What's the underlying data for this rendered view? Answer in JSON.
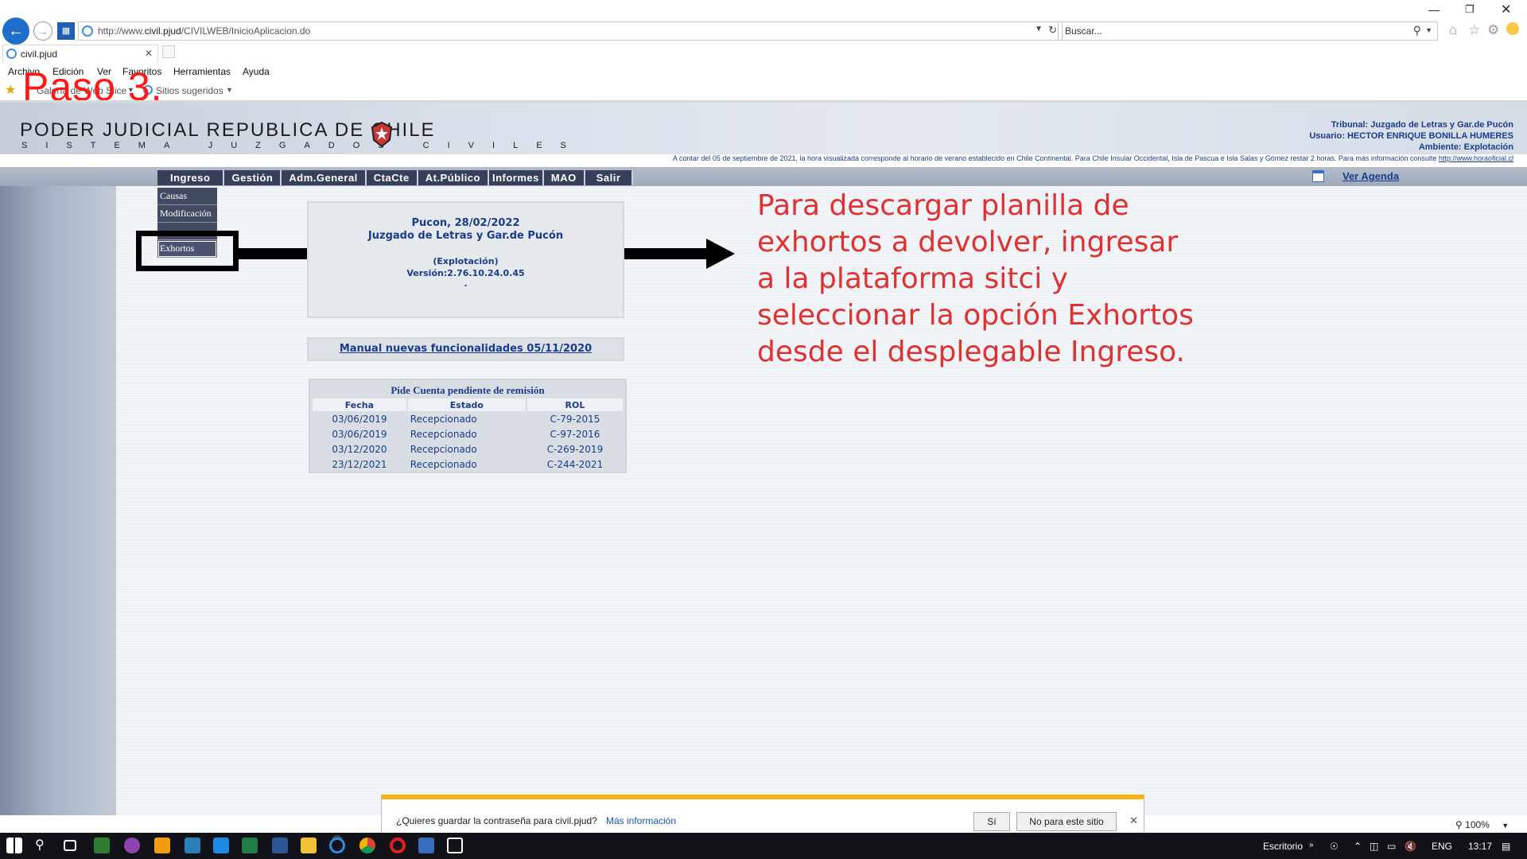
{
  "browser": {
    "url_prefix": "http://www.",
    "url_host": "civil.pjud",
    "url_path": "/CIVILWEB/InicioAplicacion.do",
    "search_placeholder": "Buscar...",
    "tab_title": "civil.pjud",
    "menu": [
      "Archivo",
      "Edición",
      "Ver",
      "Favoritos",
      "Herramientas",
      "Ayuda"
    ],
    "favorites": [
      "Galería de Web Slice",
      "Sitios sugeridos"
    ],
    "zoom": "100%"
  },
  "overlay": {
    "step_label": "Paso 3.",
    "annotation": "Para descargar planilla de exhortos a devolver, ingresar a la plataforma sitci y seleccionar la opción Exhortos desde el desplegable Ingreso."
  },
  "header": {
    "logo_title": "PODER JUDICIAL REPUBLICA DE CHILE",
    "logo_subtitle": "SISTEMA JUZGADOS CIVILES",
    "tribunal": "Tribunal: Juzgado de Letras y Gar.de Pucón",
    "usuario": "Usuario: HECTOR ENRIQUE BONILLA HUMERES",
    "ambiente": "Ambiente: Explotación",
    "notice": "A contar del 05 de septiembre de 2021, la hora visualizada corresponde al horario de verano establecido en Chile Continental. Para Chile Insular Occidental, Isla de Pascua e Isla Salas y Gómez restar 2 horas. Para más información consulte",
    "notice_link": "http://www.horaoficial.cl"
  },
  "nav": {
    "items": [
      "Ingreso",
      "Gestión",
      "Adm.General",
      "CtaCte",
      "At.Público",
      "Informes",
      "MAO",
      "Salir"
    ],
    "agenda": "Ver Agenda"
  },
  "ingreso_menu": [
    "Causas",
    "Modificación",
    "Exhortos"
  ],
  "info_panel": {
    "date_line": "Pucon, 28/02/2022",
    "court": "Juzgado de Letras y Gar.de Pucón",
    "env": "(Explotación)",
    "version": "Versión:2.76.10.24.0.45",
    "dot": "."
  },
  "manual_link": "Manual nuevas funcionalidades 05/11/2020",
  "pending_table": {
    "title": "Pide Cuenta pendiente de remisión",
    "headers": [
      "Fecha",
      "Estado",
      "ROL"
    ],
    "rows": [
      [
        "03/06/2019",
        "Recepcionado",
        "C-79-2015"
      ],
      [
        "03/06/2019",
        "Recepcionado",
        "C-97-2016"
      ],
      [
        "03/12/2020",
        "Recepcionado",
        "C-269-2019"
      ],
      [
        "23/12/2021",
        "Recepcionado",
        "C-244-2021"
      ]
    ]
  },
  "password_bar": {
    "question": "¿Quieres guardar la contraseña para civil.pjud?",
    "more_info": "Más información",
    "yes": "Sí",
    "no": "No para este sitio"
  },
  "taskbar": {
    "desktop": "Escritorio",
    "lang": "ENG",
    "time": "13:17"
  },
  "colors": {
    "nav_bg": "#37405a",
    "link_blue": "#1a3c8c",
    "annotation_red": "#e03131",
    "step_red": "#ff1818",
    "notif_accent": "#f5b414"
  }
}
